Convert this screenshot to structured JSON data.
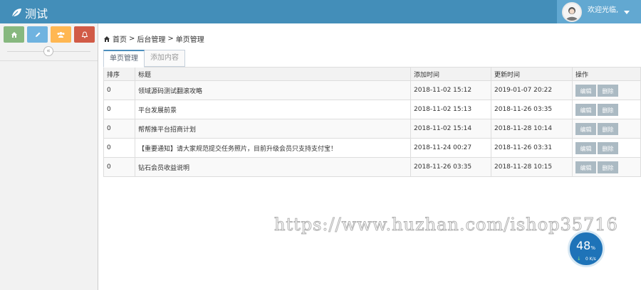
{
  "header": {
    "title": "测试",
    "welcome": "欢迎光临,"
  },
  "sidebar": {
    "shortcuts": [
      "home-icon",
      "pencil-icon",
      "group-icon",
      "bell-icon"
    ],
    "collapse": "«"
  },
  "breadcrumb": {
    "home": "首页",
    "sep1": ">",
    "level2": "后台管理",
    "sep2": ">",
    "level3": "单页管理"
  },
  "tabs": [
    {
      "label": "单页管理",
      "active": true
    },
    {
      "label": "添加内容",
      "active": false
    }
  ],
  "table": {
    "headers": [
      "排序",
      "标题",
      "添加时间",
      "更新时间",
      "操作"
    ],
    "rows": [
      {
        "sort": "0",
        "title": "领域源码测试翻滚攻略",
        "added": "2018-11-02 15:12",
        "updated": "2019-01-07 20:22"
      },
      {
        "sort": "0",
        "title": "平台发展前景",
        "added": "2018-11-02 15:13",
        "updated": "2018-11-26 03:35"
      },
      {
        "sort": "0",
        "title": "帮帮推平台招商计划",
        "added": "2018-11-02 15:14",
        "updated": "2018-11-28 10:14"
      },
      {
        "sort": "0",
        "title": "【重要通知】请大家规范提交任务照片，目前升级会员只支持支付宝！",
        "added": "2018-11-24 00:27",
        "updated": "2018-11-26 03:31"
      },
      {
        "sort": "0",
        "title": "钻石会员收益说明",
        "added": "2018-11-26 03:35",
        "updated": "2018-11-28 10:15"
      }
    ],
    "edit_label": "编辑",
    "delete_label": "删除"
  },
  "watermark": "https://www.huzhan.com/ishop35716",
  "gauge": {
    "percent": "48",
    "percent_sign": "%",
    "speed": "0 K/s"
  },
  "colors": {
    "header": "#438eb9",
    "user_box": "#62a8d1",
    "shortcut_green": "#87b87f",
    "shortcut_blue": "#6fb3e0",
    "shortcut_orange": "#ffb752",
    "shortcut_red": "#d15b47",
    "button_gray": "#abbac3"
  }
}
